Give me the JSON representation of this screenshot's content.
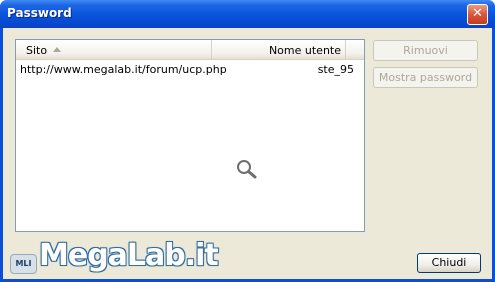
{
  "window": {
    "title": "Password",
    "close_glyph": "✕"
  },
  "table": {
    "columns": [
      "Sito",
      "Nome utente"
    ],
    "sort_column": "Sito",
    "sort_direction": "ascending",
    "rows": [
      {
        "site": "http://www.megalab.it/forum/ucp.php",
        "user": "ste_95"
      }
    ]
  },
  "buttons": {
    "remove": "Rimuovi",
    "show_passwords": "Mostra password",
    "close": "Chiudi"
  },
  "icons": {
    "sort": "sort-ascending-icon",
    "magnifier": "magnifier-icon",
    "close": "close-icon"
  },
  "watermark": {
    "logo_text": "MLI",
    "brand": "MegaLab.it"
  },
  "colors": {
    "titlebar": "#0a55dc",
    "client_background": "#ece9d8",
    "list_border": "#7f9db9",
    "disabled_text": "#aca899"
  }
}
